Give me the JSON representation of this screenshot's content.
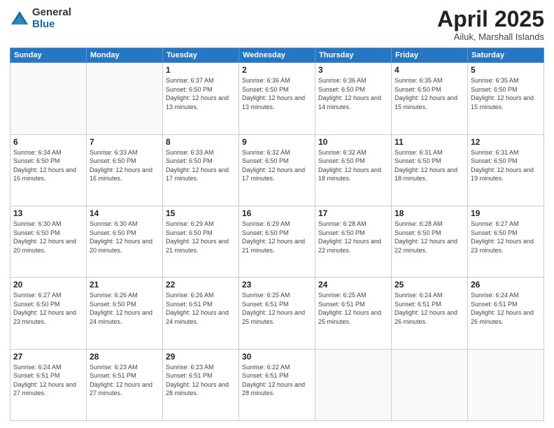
{
  "logo": {
    "general": "General",
    "blue": "Blue"
  },
  "title": {
    "month_year": "April 2025",
    "location": "Ailuk, Marshall Islands"
  },
  "weekdays": [
    "Sunday",
    "Monday",
    "Tuesday",
    "Wednesday",
    "Thursday",
    "Friday",
    "Saturday"
  ],
  "weeks": [
    [
      {
        "day": "",
        "sunrise": "",
        "sunset": "",
        "daylight": ""
      },
      {
        "day": "",
        "sunrise": "",
        "sunset": "",
        "daylight": ""
      },
      {
        "day": "1",
        "sunrise": "Sunrise: 6:37 AM",
        "sunset": "Sunset: 6:50 PM",
        "daylight": "Daylight: 12 hours and 13 minutes."
      },
      {
        "day": "2",
        "sunrise": "Sunrise: 6:36 AM",
        "sunset": "Sunset: 6:50 PM",
        "daylight": "Daylight: 12 hours and 13 minutes."
      },
      {
        "day": "3",
        "sunrise": "Sunrise: 6:36 AM",
        "sunset": "Sunset: 6:50 PM",
        "daylight": "Daylight: 12 hours and 14 minutes."
      },
      {
        "day": "4",
        "sunrise": "Sunrise: 6:35 AM",
        "sunset": "Sunset: 6:50 PM",
        "daylight": "Daylight: 12 hours and 15 minutes."
      },
      {
        "day": "5",
        "sunrise": "Sunrise: 6:35 AM",
        "sunset": "Sunset: 6:50 PM",
        "daylight": "Daylight: 12 hours and 15 minutes."
      }
    ],
    [
      {
        "day": "6",
        "sunrise": "Sunrise: 6:34 AM",
        "sunset": "Sunset: 6:50 PM",
        "daylight": "Daylight: 12 hours and 16 minutes."
      },
      {
        "day": "7",
        "sunrise": "Sunrise: 6:33 AM",
        "sunset": "Sunset: 6:50 PM",
        "daylight": "Daylight: 12 hours and 16 minutes."
      },
      {
        "day": "8",
        "sunrise": "Sunrise: 6:33 AM",
        "sunset": "Sunset: 6:50 PM",
        "daylight": "Daylight: 12 hours and 17 minutes."
      },
      {
        "day": "9",
        "sunrise": "Sunrise: 6:32 AM",
        "sunset": "Sunset: 6:50 PM",
        "daylight": "Daylight: 12 hours and 17 minutes."
      },
      {
        "day": "10",
        "sunrise": "Sunrise: 6:32 AM",
        "sunset": "Sunset: 6:50 PM",
        "daylight": "Daylight: 12 hours and 18 minutes."
      },
      {
        "day": "11",
        "sunrise": "Sunrise: 6:31 AM",
        "sunset": "Sunset: 6:50 PM",
        "daylight": "Daylight: 12 hours and 18 minutes."
      },
      {
        "day": "12",
        "sunrise": "Sunrise: 6:31 AM",
        "sunset": "Sunset: 6:50 PM",
        "daylight": "Daylight: 12 hours and 19 minutes."
      }
    ],
    [
      {
        "day": "13",
        "sunrise": "Sunrise: 6:30 AM",
        "sunset": "Sunset: 6:50 PM",
        "daylight": "Daylight: 12 hours and 20 minutes."
      },
      {
        "day": "14",
        "sunrise": "Sunrise: 6:30 AM",
        "sunset": "Sunset: 6:50 PM",
        "daylight": "Daylight: 12 hours and 20 minutes."
      },
      {
        "day": "15",
        "sunrise": "Sunrise: 6:29 AM",
        "sunset": "Sunset: 6:50 PM",
        "daylight": "Daylight: 12 hours and 21 minutes."
      },
      {
        "day": "16",
        "sunrise": "Sunrise: 6:29 AM",
        "sunset": "Sunset: 6:50 PM",
        "daylight": "Daylight: 12 hours and 21 minutes."
      },
      {
        "day": "17",
        "sunrise": "Sunrise: 6:28 AM",
        "sunset": "Sunset: 6:50 PM",
        "daylight": "Daylight: 12 hours and 22 minutes."
      },
      {
        "day": "18",
        "sunrise": "Sunrise: 6:28 AM",
        "sunset": "Sunset: 6:50 PM",
        "daylight": "Daylight: 12 hours and 22 minutes."
      },
      {
        "day": "19",
        "sunrise": "Sunrise: 6:27 AM",
        "sunset": "Sunset: 6:50 PM",
        "daylight": "Daylight: 12 hours and 23 minutes."
      }
    ],
    [
      {
        "day": "20",
        "sunrise": "Sunrise: 6:27 AM",
        "sunset": "Sunset: 6:50 PM",
        "daylight": "Daylight: 12 hours and 23 minutes."
      },
      {
        "day": "21",
        "sunrise": "Sunrise: 6:26 AM",
        "sunset": "Sunset: 6:50 PM",
        "daylight": "Daylight: 12 hours and 24 minutes."
      },
      {
        "day": "22",
        "sunrise": "Sunrise: 6:26 AM",
        "sunset": "Sunset: 6:51 PM",
        "daylight": "Daylight: 12 hours and 24 minutes."
      },
      {
        "day": "23",
        "sunrise": "Sunrise: 6:25 AM",
        "sunset": "Sunset: 6:51 PM",
        "daylight": "Daylight: 12 hours and 25 minutes."
      },
      {
        "day": "24",
        "sunrise": "Sunrise: 6:25 AM",
        "sunset": "Sunset: 6:51 PM",
        "daylight": "Daylight: 12 hours and 25 minutes."
      },
      {
        "day": "25",
        "sunrise": "Sunrise: 6:24 AM",
        "sunset": "Sunset: 6:51 PM",
        "daylight": "Daylight: 12 hours and 26 minutes."
      },
      {
        "day": "26",
        "sunrise": "Sunrise: 6:24 AM",
        "sunset": "Sunset: 6:51 PM",
        "daylight": "Daylight: 12 hours and 26 minutes."
      }
    ],
    [
      {
        "day": "27",
        "sunrise": "Sunrise: 6:24 AM",
        "sunset": "Sunset: 6:51 PM",
        "daylight": "Daylight: 12 hours and 27 minutes."
      },
      {
        "day": "28",
        "sunrise": "Sunrise: 6:23 AM",
        "sunset": "Sunset: 6:51 PM",
        "daylight": "Daylight: 12 hours and 27 minutes."
      },
      {
        "day": "29",
        "sunrise": "Sunrise: 6:23 AM",
        "sunset": "Sunset: 6:51 PM",
        "daylight": "Daylight: 12 hours and 28 minutes."
      },
      {
        "day": "30",
        "sunrise": "Sunrise: 6:22 AM",
        "sunset": "Sunset: 6:51 PM",
        "daylight": "Daylight: 12 hours and 28 minutes."
      },
      {
        "day": "",
        "sunrise": "",
        "sunset": "",
        "daylight": ""
      },
      {
        "day": "",
        "sunrise": "",
        "sunset": "",
        "daylight": ""
      },
      {
        "day": "",
        "sunrise": "",
        "sunset": "",
        "daylight": ""
      }
    ]
  ]
}
